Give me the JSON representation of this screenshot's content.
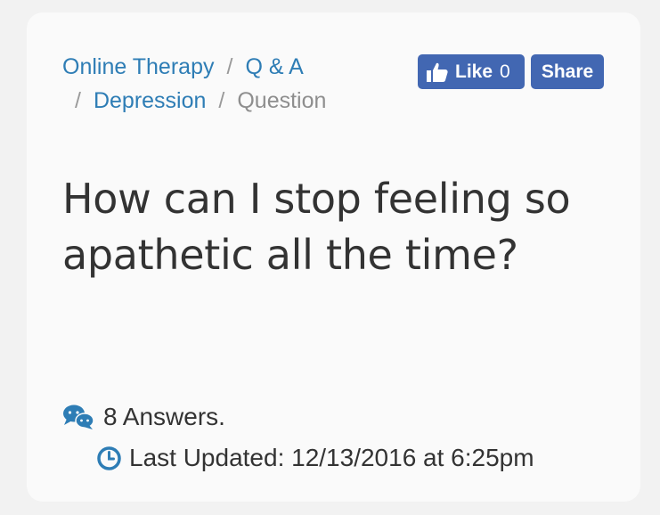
{
  "breadcrumb": {
    "items": [
      {
        "label": "Online Therapy"
      },
      {
        "label": "Q & A"
      },
      {
        "label": "Depression"
      },
      {
        "label": "Question"
      }
    ],
    "separator": "/"
  },
  "social": {
    "like_label": "Like",
    "like_count": "0",
    "share_label": "Share",
    "brand_color": "#4267b2"
  },
  "question": {
    "title": "How can I stop feeling so apathetic all the time?"
  },
  "meta": {
    "answers_text": "8 Answers.",
    "updated_text": "Last Updated: 12/13/2016 at 6:25pm",
    "icon_color": "#2e7db5"
  }
}
